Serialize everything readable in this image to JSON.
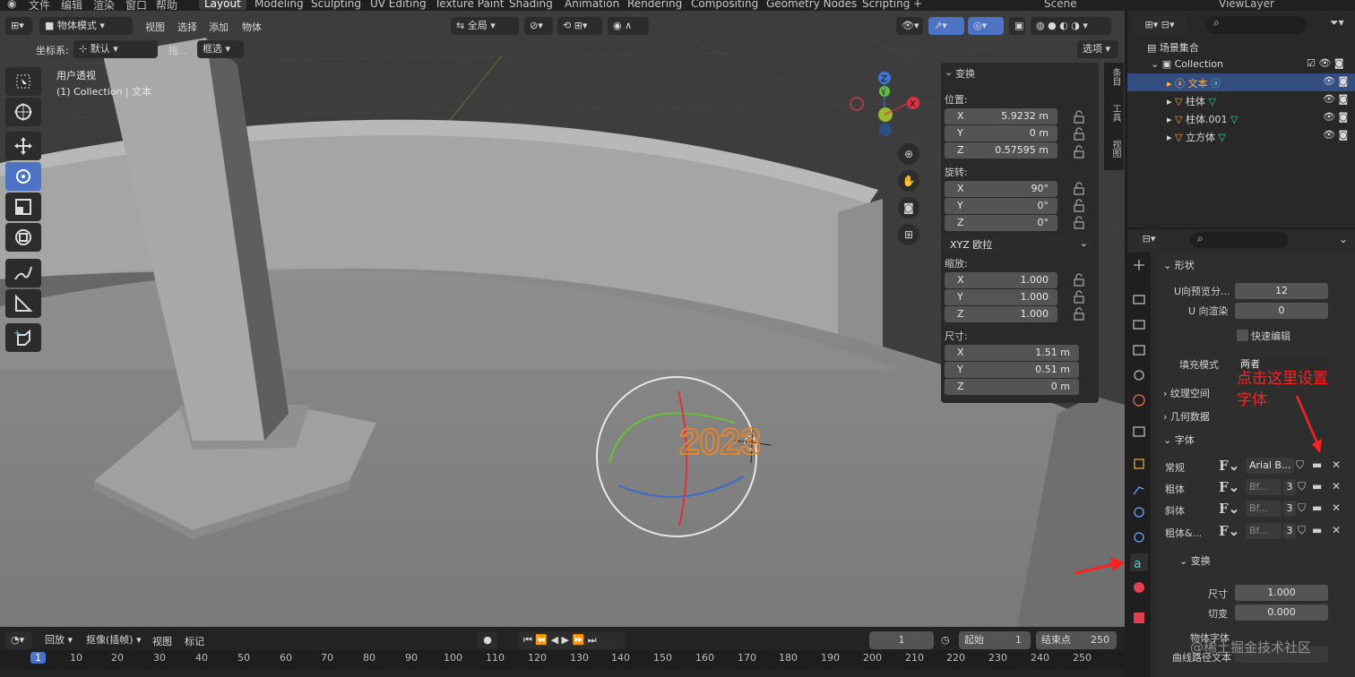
{
  "topbar": {
    "menus": [
      "文件",
      "编辑",
      "渲染",
      "窗口",
      "帮助"
    ],
    "workspaces": [
      "Layout",
      "Modeling",
      "Sculpting",
      "UV Editing",
      "Texture Paint",
      "Shading",
      "Animation",
      "Rendering",
      "Compositing",
      "Geometry Nodes",
      "Scripting"
    ],
    "active_workspace": "Layout",
    "scene": "Scene",
    "view_layer": "ViewLayer"
  },
  "header": {
    "mode": "物体模式",
    "view": "视图",
    "select": "选择",
    "add": "添加",
    "object": "物体",
    "orientation": "全局",
    "options": "选项"
  },
  "header2": {
    "coord_label": "坐标系:",
    "coord_value": "默认",
    "drag_label": "拖...",
    "select_mode": "框选"
  },
  "viewport": {
    "line1": "用户透视",
    "line2": "(1) Collection | 文本",
    "text_object": "2023"
  },
  "npanel": {
    "section": "变换",
    "location_label": "位置:",
    "location": {
      "x": "5.9232 m",
      "y": "0 m",
      "z": "0.57595 m"
    },
    "rotation_label": "旋转:",
    "rotation": {
      "x": "90°",
      "y": "0°",
      "z": "0°"
    },
    "rotation_mode": "XYZ 欧拉",
    "scale_label": "缩放:",
    "scale": {
      "x": "1.000",
      "y": "1.000",
      "z": "1.000"
    },
    "dimensions_label": "尺寸:",
    "dimensions": {
      "x": "1.51 m",
      "y": "0.51 m",
      "z": "0 m"
    },
    "axes": {
      "x": "X",
      "y": "Y",
      "z": "Z"
    }
  },
  "sidetabs": [
    "条目",
    "工具",
    "视图"
  ],
  "outliner": {
    "root": "场景集合",
    "collection": "Collection",
    "items": [
      {
        "name": "文本",
        "type": "text"
      },
      {
        "name": "柱体",
        "type": "mesh"
      },
      {
        "name": "柱体.001",
        "type": "mesh"
      },
      {
        "name": "立方体",
        "type": "mesh"
      }
    ]
  },
  "properties": {
    "shape_section": "形状",
    "u_preview_label": "U向预览分...",
    "u_preview_value": "12",
    "u_render_label": "U 向渲染",
    "u_render_value": "0",
    "fast_edit": "快速编辑",
    "fill_mode_label": "填充模式",
    "fill_mode_value": "两者",
    "texture_space": "纹理空间",
    "geometry": "几何数据",
    "font_section": "字体",
    "fonts": [
      {
        "label": "常规",
        "font": "Arial B...",
        "users": ""
      },
      {
        "label": "粗体",
        "font": "Bf...",
        "users": "3"
      },
      {
        "label": "斜体",
        "font": "Bf...",
        "users": "3"
      },
      {
        "label": "粗体&...",
        "font": "Bf...",
        "users": "3"
      }
    ],
    "transform_section": "变换",
    "size_label": "尺寸",
    "size_value": "1.000",
    "shear_label": "切变",
    "shear_value": "0.000",
    "object_font_label": "物体字体",
    "curve_text_label": "曲线路径文本"
  },
  "annotation": {
    "text_line1": "点击这里设置",
    "text_line2": "字体"
  },
  "timeline": {
    "playback": "回放",
    "keying": "抠像(插帧)",
    "view": "视图",
    "marker": "标记",
    "current_frame": "1",
    "start_label": "起始",
    "start_value": "1",
    "end_label": "结束点",
    "end_value": "250",
    "ruler": [
      "1",
      "10",
      "20",
      "30",
      "40",
      "50",
      "60",
      "70",
      "80",
      "90",
      "100",
      "110",
      "120",
      "130",
      "140",
      "150",
      "160",
      "170",
      "180",
      "190",
      "200",
      "210",
      "220",
      "230",
      "240",
      "250"
    ]
  },
  "watermark": "@稀土掘金技术社区"
}
